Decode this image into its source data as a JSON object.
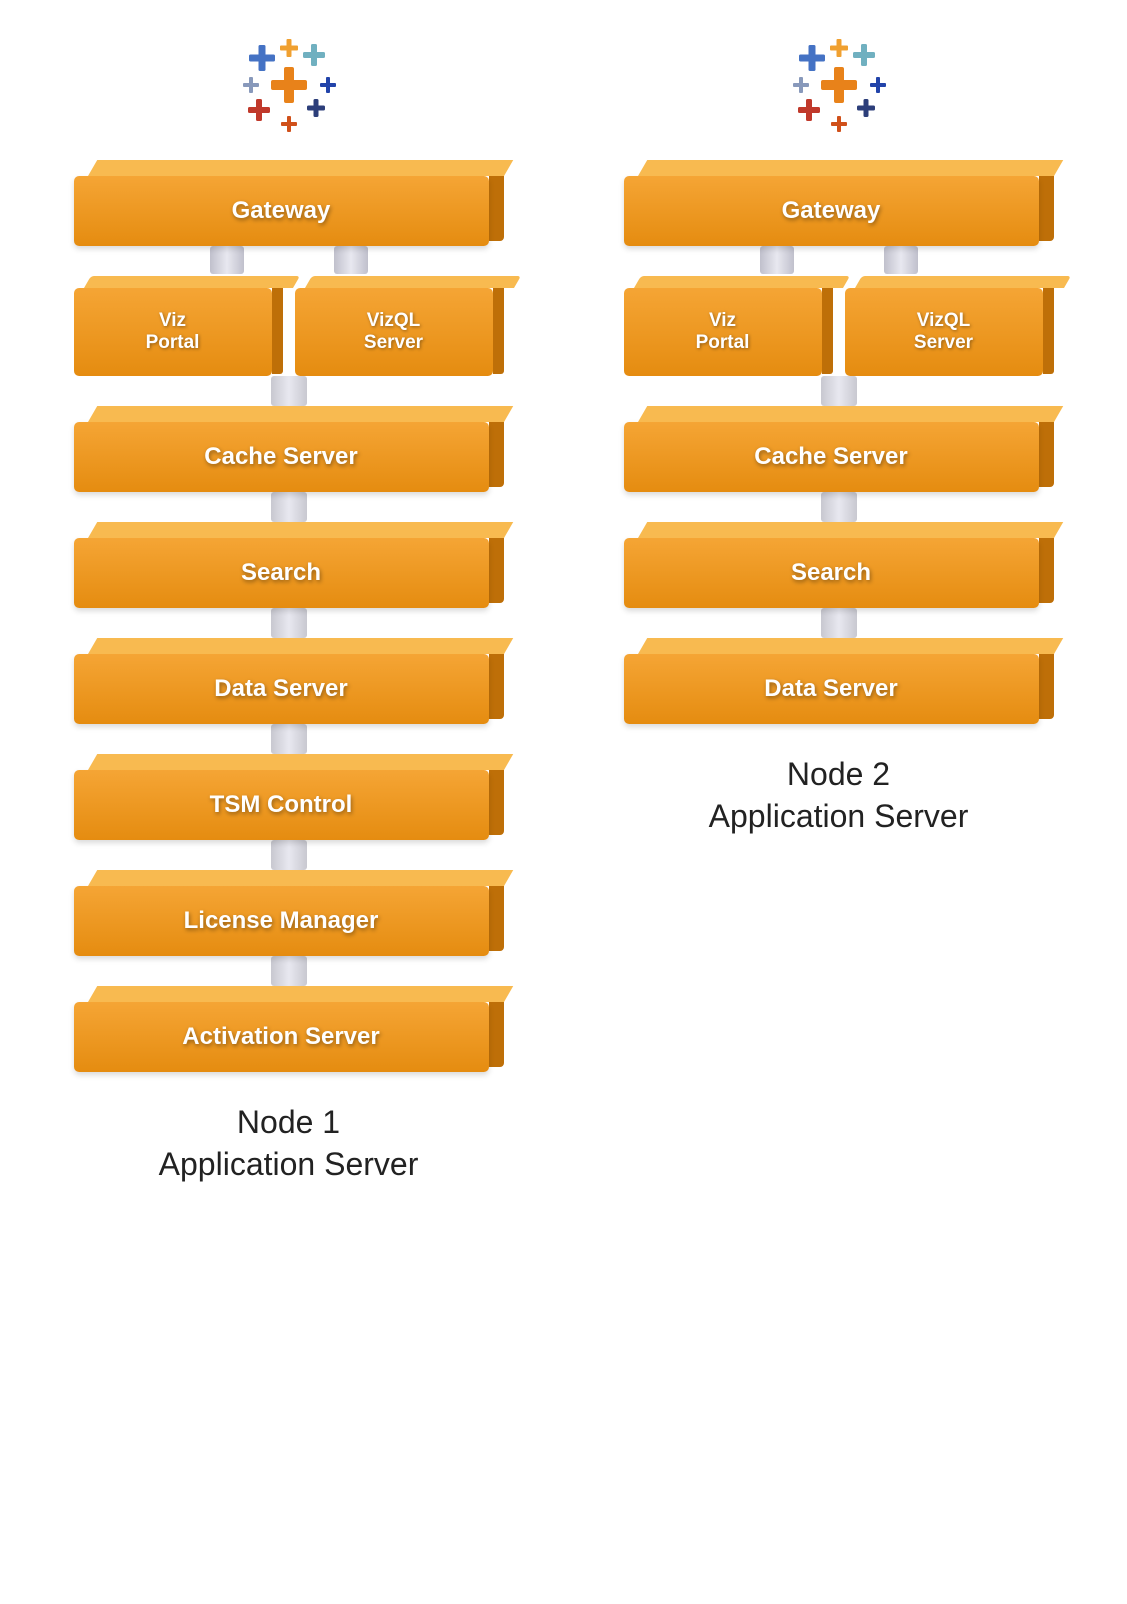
{
  "nodes": [
    {
      "id": "node1",
      "label_line1": "Node 1",
      "label_line2": "Application Server",
      "blocks": [
        {
          "id": "gateway1",
          "label": "Gateway",
          "type": "single"
        },
        {
          "id": "vizportal1",
          "label": "Viz\nPortal",
          "type": "split-left"
        },
        {
          "id": "vizql1",
          "label": "VizQL\nServer",
          "type": "split-right"
        },
        {
          "id": "cache1",
          "label": "Cache Server",
          "type": "single"
        },
        {
          "id": "search1",
          "label": "Search",
          "type": "single"
        },
        {
          "id": "dataserver1",
          "label": "Data Server",
          "type": "single"
        },
        {
          "id": "tsmcontrol1",
          "label": "TSM Control",
          "type": "single"
        },
        {
          "id": "licmgr1",
          "label": "License Manager",
          "type": "single"
        },
        {
          "id": "actserver1",
          "label": "Activation Server",
          "type": "single"
        }
      ]
    },
    {
      "id": "node2",
      "label_line1": "Node 2",
      "label_line2": "Application Server",
      "blocks": [
        {
          "id": "gateway2",
          "label": "Gateway",
          "type": "single"
        },
        {
          "id": "vizportal2",
          "label": "Viz\nPortal",
          "type": "split-left"
        },
        {
          "id": "vizql2",
          "label": "VizQL\nServer",
          "type": "split-right"
        },
        {
          "id": "cache2",
          "label": "Cache Server",
          "type": "single"
        },
        {
          "id": "search2",
          "label": "Search",
          "type": "single"
        },
        {
          "id": "dataserver2",
          "label": "Data Server",
          "type": "single"
        }
      ]
    }
  ],
  "colors": {
    "front_top": "#f5a535",
    "front_bottom": "#e88a10",
    "top_face": "#f8c060",
    "right_face": "#b86808",
    "connector": "#d0d0dc",
    "text": "#ffffff"
  }
}
